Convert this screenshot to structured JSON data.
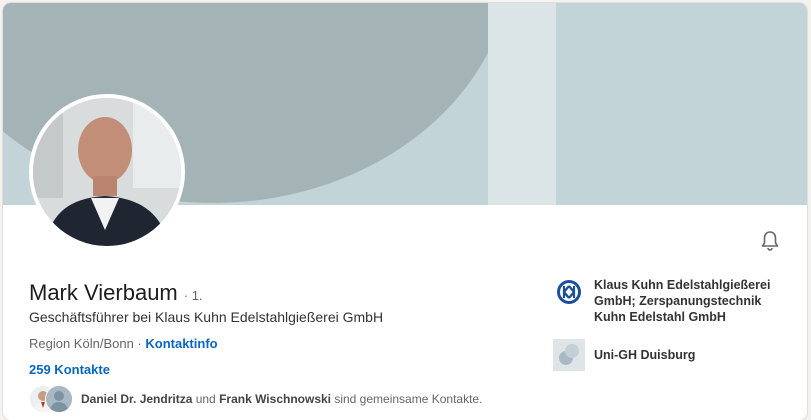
{
  "profile": {
    "name": "Mark Vierbaum",
    "degree": "· 1.",
    "headline": "Geschäftsführer bei Klaus Kuhn Edelstahlgießerei GmbH",
    "location": "Region Köln/Bonn",
    "separator": " · ",
    "contact_info_label": "Kontaktinfo",
    "connections": "259 Kontakte"
  },
  "mutual": {
    "person1": "Daniel Dr. Jendritza",
    "joiner": " und ",
    "person2": "Frank Wischnowski",
    "suffix": " sind gemeinsame Kontakte."
  },
  "right": {
    "company": "Klaus Kuhn Edelstahlgießerei GmbH; Zerspanungstechnik Kuhn Edelstahl GmbH",
    "school": "Uni-GH Duisburg"
  },
  "icons": {
    "bell": "bell-icon",
    "company_logo": "company-logo-icon",
    "school_logo": "school-logo-icon"
  },
  "colors": {
    "link": "#0a66c2",
    "banner": "#c2d4d8",
    "banner_circle": "#a3b3b6"
  }
}
